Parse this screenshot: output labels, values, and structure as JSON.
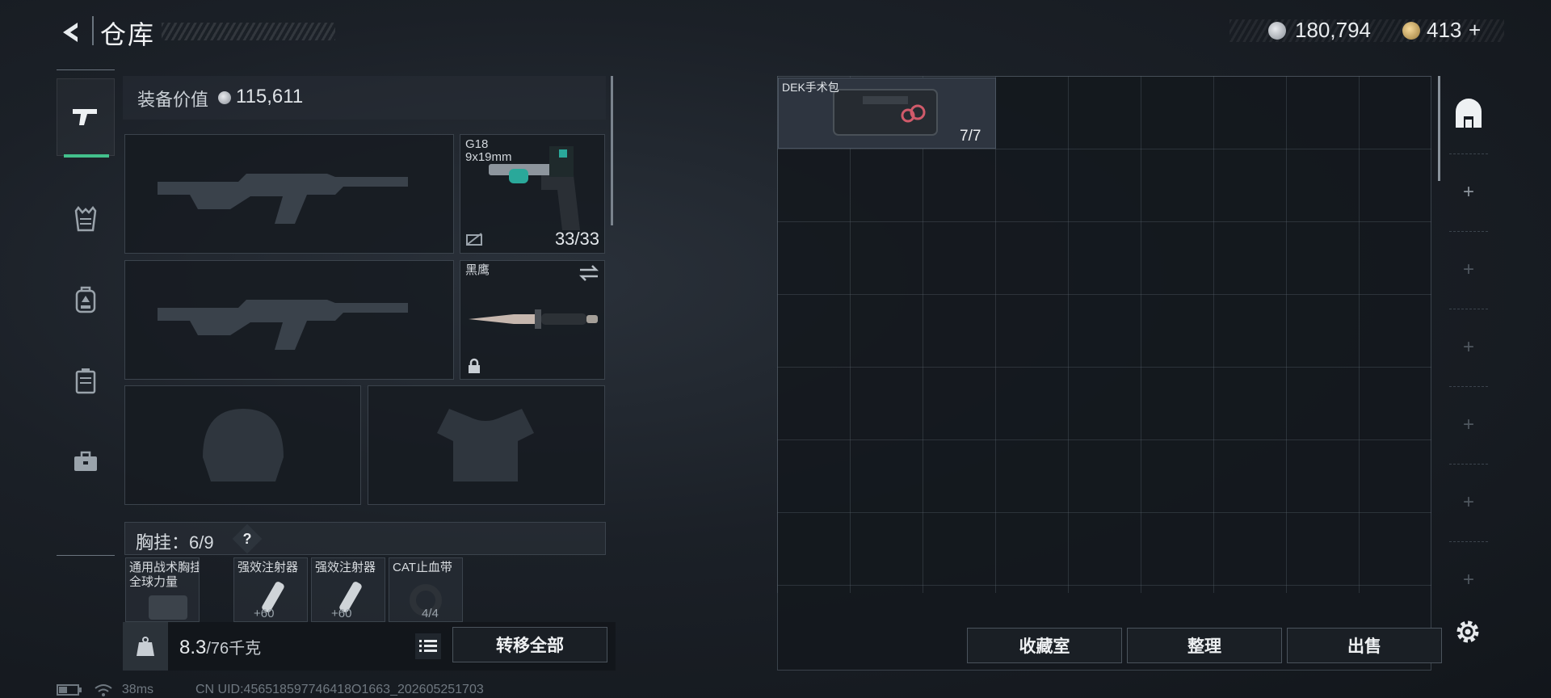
{
  "header": {
    "title": "仓库",
    "currency_silver": "180,794",
    "currency_gold": "413",
    "gold_add": "+"
  },
  "loadout": {
    "value_label": "装备价值",
    "value": "115,611",
    "sidearm": {
      "name": "G18",
      "caliber": "9x19mm",
      "ammo": "33/33"
    },
    "melee": {
      "name": "黑鹰"
    },
    "chest_label": "胸挂：",
    "chest_capacity": "6/9",
    "help": "?",
    "chest_items": [
      {
        "label": "通用战术胸挂\n全球力量"
      },
      {
        "label": "强效注射器",
        "extra": "+60"
      },
      {
        "label": "强效注射器",
        "extra": "+60"
      },
      {
        "label": "CAT止血带",
        "extra": "4/4"
      }
    ],
    "weight_value": "8.3",
    "weight_max": "/76千克",
    "transfer_all": "转移全部"
  },
  "storage": {
    "item_name": "DEK手术包",
    "item_count": "7/7",
    "btn_collection": "收藏室",
    "btn_sort": "整理",
    "btn_sell": "出售",
    "add_symbol": "+"
  },
  "status": {
    "ping": "38ms",
    "uid": "CN UID:456518597746418O1663_202605251703"
  },
  "colors": {
    "accent_green": "#43c08c",
    "background": "#1b2027"
  },
  "icons": {
    "back": "chevron-left-icon",
    "nav": [
      "pistol-icon",
      "vest-icon",
      "backpack-icon",
      "case-icon",
      "toolbox-icon"
    ],
    "rail_top": "safe-icon",
    "settings": "gear-icon"
  }
}
